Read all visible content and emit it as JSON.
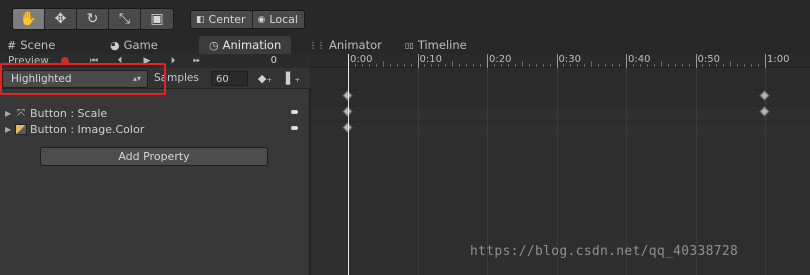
{
  "toolbar": {
    "transform_tools": [
      {
        "name": "hand-tool",
        "icon": "✋",
        "active": true
      },
      {
        "name": "move-tool",
        "icon": "✥",
        "active": false
      },
      {
        "name": "rotate-tool",
        "icon": "↻",
        "active": false
      },
      {
        "name": "scale-tool",
        "icon": "⤡",
        "active": false
      },
      {
        "name": "rect-tool",
        "icon": "▣",
        "active": false
      }
    ],
    "pivot_label": "Center",
    "space_label": "Local"
  },
  "tabs": [
    {
      "label": "Scene",
      "icon": "#"
    },
    {
      "label": "Game",
      "icon": "◕"
    },
    {
      "label": "Animation",
      "icon": "◷"
    },
    {
      "label": "Animator",
      "icon": "⋮⋮"
    },
    {
      "label": "Timeline",
      "icon": "▯▯"
    }
  ],
  "animation": {
    "preview_label": "Preview",
    "frame_value": "0",
    "clip_name": "Highlighted",
    "samples_label": "Samples",
    "samples_value": "60",
    "properties": [
      {
        "label": "Button : Scale",
        "icon": "scale-icon"
      },
      {
        "label": "Button : Image.Color",
        "icon": "image-icon"
      }
    ],
    "add_property_label": "Add Property",
    "time_labels": [
      "0:00",
      "0:10",
      "0:20",
      "0:30",
      "0:40",
      "0:50",
      "1:00"
    ],
    "keyframe_times": [
      "0:00",
      "1:00"
    ]
  },
  "watermark": "https://blog.csdn.net/qq_40338728",
  "colors": {
    "highlight_border": "#e8231f",
    "record_dot": "#cf2b2b",
    "playhead": "#e8e8e8"
  }
}
